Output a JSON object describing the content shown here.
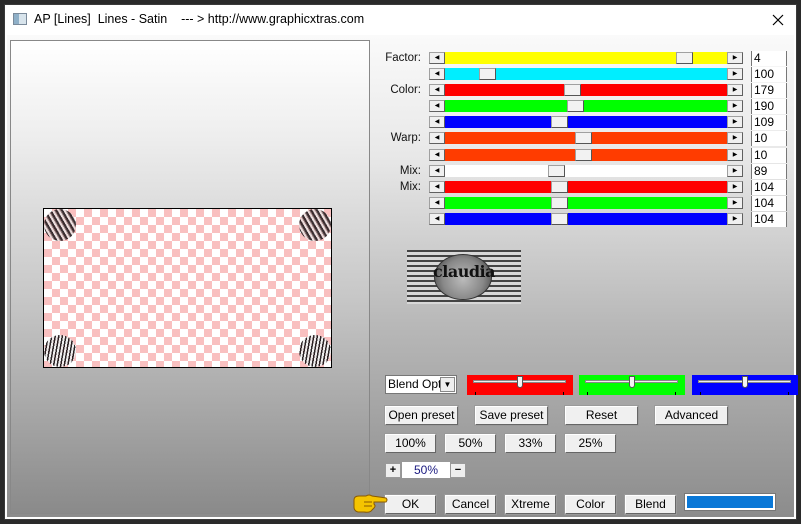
{
  "window": {
    "title": "AP [Lines]  Lines - Satin    --- > http://www.graphicxtras.com",
    "icon": "app-icon",
    "close_icon": "close-icon"
  },
  "sliders": [
    {
      "label": "Factor:",
      "color": "#ffff00",
      "position": 0.87,
      "value": "4"
    },
    {
      "label": "",
      "color": "#00eeff",
      "position": 0.13,
      "value": "100"
    },
    {
      "label": "Color:",
      "color": "#ff0000",
      "position": 0.45,
      "value": "179"
    },
    {
      "label": "",
      "color": "#00ff00",
      "position": 0.46,
      "value": "190"
    },
    {
      "label": "",
      "color": "#0000ff",
      "position": 0.4,
      "value": "109"
    },
    {
      "label": "Warp:",
      "color": "#ff3c00",
      "position": 0.49,
      "value": "10"
    },
    {
      "label": "",
      "color": "#ff3c00",
      "position": 0.49,
      "value": "10"
    },
    {
      "label": "Mix:",
      "color": "#ffffff",
      "position": 0.39,
      "value": "89"
    },
    {
      "label": "Mix:",
      "color": "#ff0000",
      "position": 0.4,
      "value": "104"
    },
    {
      "label": "",
      "color": "#00ff00",
      "position": 0.4,
      "value": "104"
    },
    {
      "label": "",
      "color": "#0000ff",
      "position": 0.4,
      "value": "104"
    }
  ],
  "logo": {
    "text": "claudia"
  },
  "blend": {
    "select_value": "Blend Opti",
    "mini_sliders": [
      {
        "color": "#ff0000",
        "position": 0.5
      },
      {
        "color": "#00ff00",
        "position": 0.5
      },
      {
        "color": "#0000ff",
        "position": 0.5
      }
    ]
  },
  "preset_buttons": {
    "open": "Open preset",
    "save": "Save preset",
    "reset": "Reset",
    "advanced": "Advanced"
  },
  "zoom_buttons": [
    "100%",
    "50%",
    "33%",
    "25%"
  ],
  "zoom_control": {
    "plus": "+",
    "value": "50%",
    "minus": "−"
  },
  "action_buttons": {
    "ok": "OK",
    "cancel": "Cancel",
    "xtreme": "Xtreme",
    "color": "Color",
    "blend": "Blend"
  },
  "color_swatch": "#0a78d7"
}
